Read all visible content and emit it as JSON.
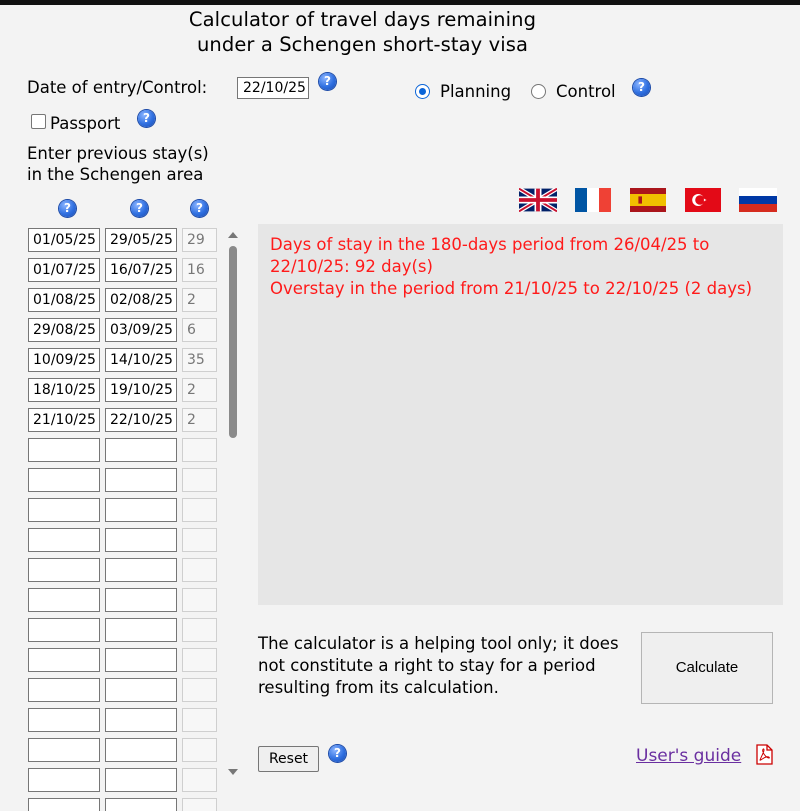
{
  "title_line1": "Calculator of travel days remaining",
  "title_line2": "under a Schengen short-stay visa",
  "date_label": "Date of entry/Control:",
  "date_value": "22/10/25",
  "mode": {
    "planning_label": "Planning",
    "control_label": "Control",
    "selected": "Planning"
  },
  "passport_label": "Passport",
  "passport_checked": false,
  "prev_stays_line1": "Enter previous stay(s)",
  "prev_stays_line2": "in the Schengen area",
  "help_glyph": "?",
  "help_icon": "question-mark-icon",
  "languages": [
    "uk-flag",
    "france-flag",
    "spain-flag",
    "turkey-flag",
    "russia-flag"
  ],
  "stays": [
    {
      "from": "01/05/25",
      "to": "29/05/25",
      "days": "29"
    },
    {
      "from": "01/07/25",
      "to": "16/07/25",
      "days": "16"
    },
    {
      "from": "01/08/25",
      "to": "02/08/25",
      "days": "2"
    },
    {
      "from": "29/08/25",
      "to": "03/09/25",
      "days": "6"
    },
    {
      "from": "10/09/25",
      "to": "14/10/25",
      "days": "35"
    },
    {
      "from": "18/10/25",
      "to": "19/10/25",
      "days": "2"
    },
    {
      "from": "21/10/25",
      "to": "22/10/25",
      "days": "2"
    },
    {
      "from": "",
      "to": "",
      "days": ""
    },
    {
      "from": "",
      "to": "",
      "days": ""
    },
    {
      "from": "",
      "to": "",
      "days": ""
    },
    {
      "from": "",
      "to": "",
      "days": ""
    },
    {
      "from": "",
      "to": "",
      "days": ""
    },
    {
      "from": "",
      "to": "",
      "days": ""
    },
    {
      "from": "",
      "to": "",
      "days": ""
    },
    {
      "from": "",
      "to": "",
      "days": ""
    },
    {
      "from": "",
      "to": "",
      "days": ""
    },
    {
      "from": "",
      "to": "",
      "days": ""
    },
    {
      "from": "",
      "to": "",
      "days": ""
    },
    {
      "from": "",
      "to": "",
      "days": ""
    },
    {
      "from": "",
      "to": "",
      "days": ""
    }
  ],
  "result_line1": "Days of stay in the 180-days period from 26/04/25 to 22/10/25: 92 day(s)",
  "result_line2": "Overstay in the period from 21/10/25 to 22/10/25 (2 days)",
  "note": "The calculator is a helping tool only; it does not constitute a right to stay for a period resulting from its calculation.",
  "calculate_label": "Calculate",
  "reset_label": "Reset",
  "guide_label": "User's guide",
  "colors": {
    "result_text": "#ff1a1a",
    "result_bg": "#e6e6e6",
    "link": "#6a2fa0",
    "help_icon": "#2f6fe0"
  }
}
